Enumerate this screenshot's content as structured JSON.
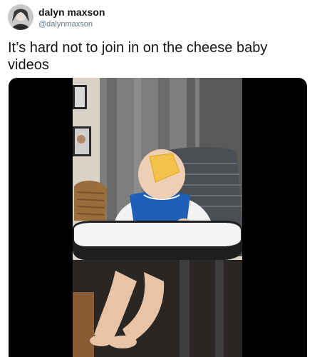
{
  "tweet": {
    "display_name": "dalyn maxson",
    "handle": "@dalynmaxson",
    "text": "It’s hard not to join in on the cheese baby videos"
  },
  "media": {
    "type": "video",
    "description_icon": "video-thumbnail"
  }
}
